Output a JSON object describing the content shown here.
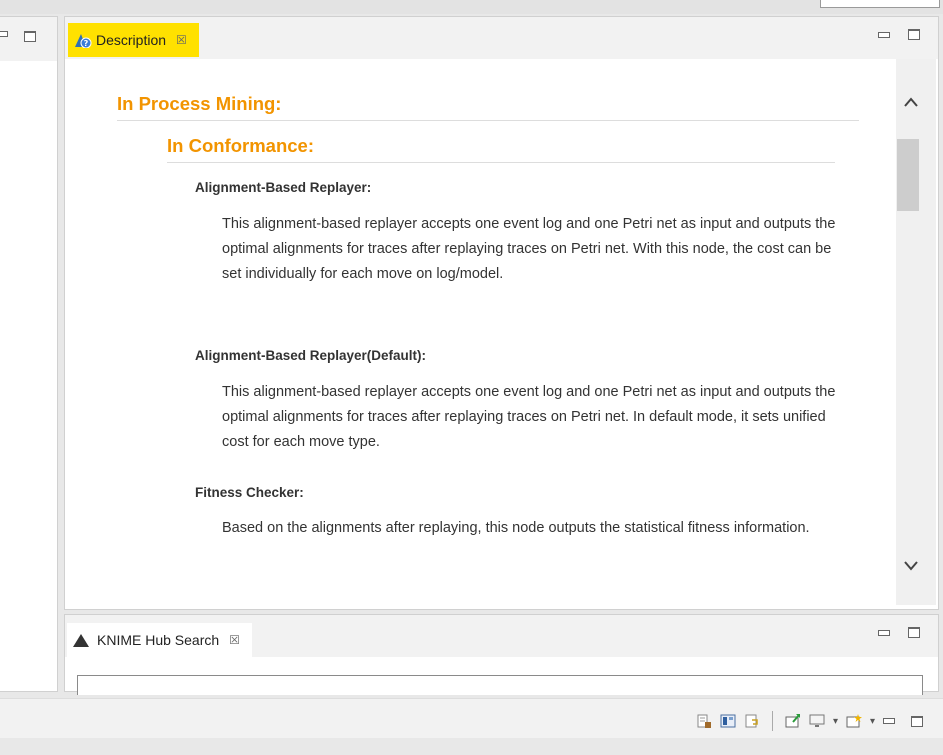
{
  "description_tab": {
    "label": "Description",
    "close_glyph": "☒"
  },
  "content": {
    "heading1": "In Process Mining:",
    "heading2": "In Conformance:",
    "entries": [
      {
        "term": "Alignment-Based Replayer:",
        "definition": "This alignment-based replayer accepts one event log and one Petri net as input and outputs the optimal alignments for traces after replaying traces on Petri net. With this node, the cost can be set individually for each move on log/model."
      },
      {
        "term": "Alignment-Based Replayer(Default):",
        "definition": "This alignment-based replayer accepts one event log and one Petri net as input and outputs the optimal alignments for traces after replaying traces on Petri net. In default mode, it sets unified cost for each move type."
      },
      {
        "term": "Fitness Checker:",
        "definition": "Based on the alignments after replaying, this node outputs the statistical fitness information."
      }
    ]
  },
  "hub_tab": {
    "label": "KNIME Hub Search",
    "close_glyph": "☒"
  },
  "scroll": {
    "up_glyph": "^",
    "down_glyph": "v"
  },
  "toolbar": {
    "dropdown_glyph": "▾"
  },
  "colors": {
    "active_tab": "#ffe100",
    "heading": "#f29400"
  }
}
